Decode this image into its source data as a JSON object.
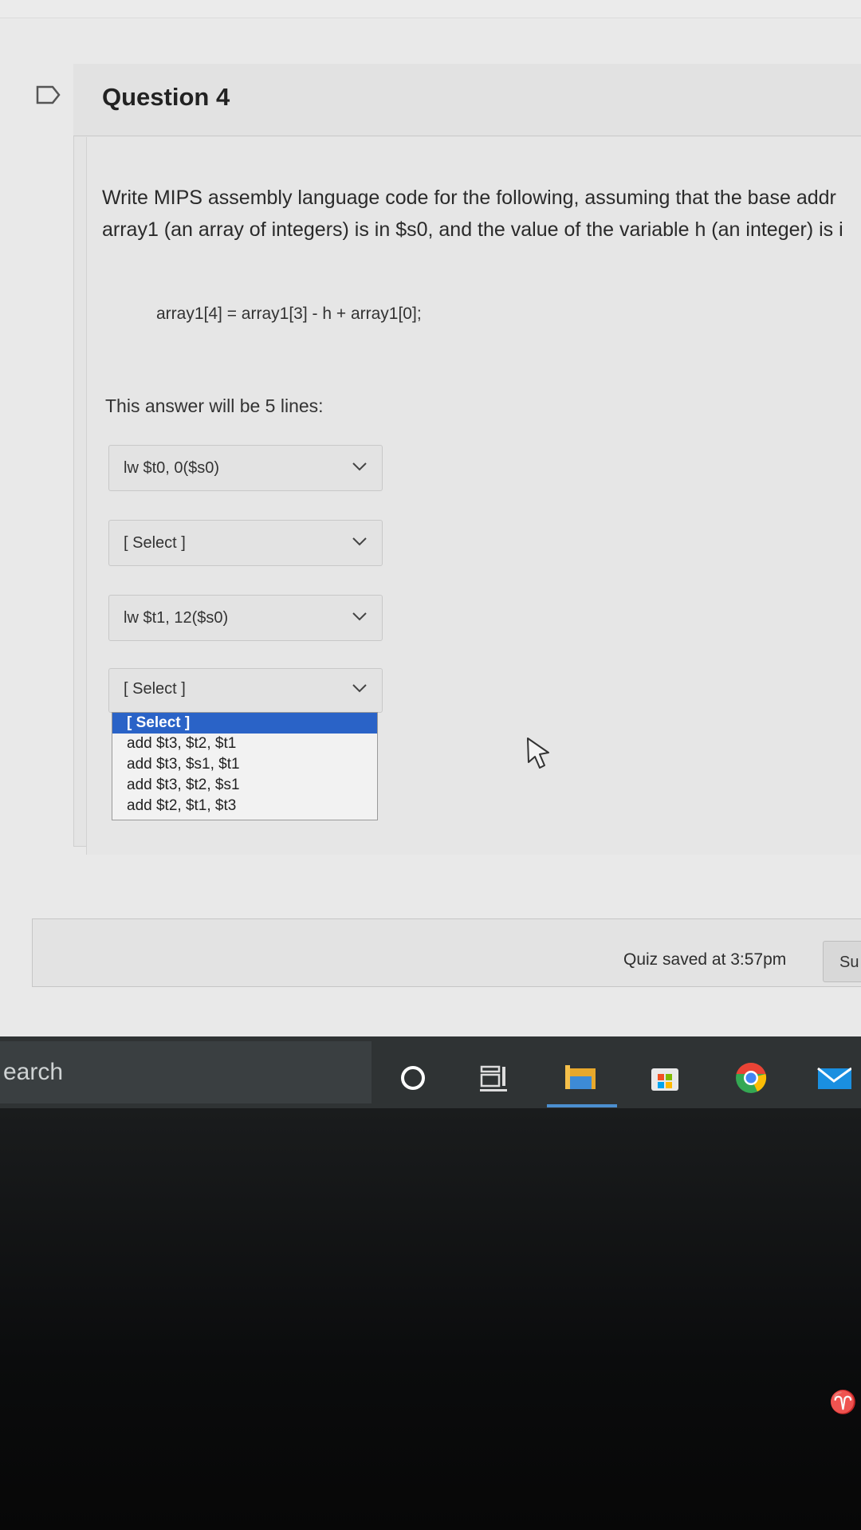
{
  "question": {
    "title": "Question 4",
    "prompt_line1": "Write MIPS assembly language code for the following, assuming that the base addr",
    "prompt_line2": "array1 (an array of integers) is in $s0, and the value of the variable h (an integer) is i",
    "code": "array1[4] = array1[3] - h + array1[0];",
    "hint": "This answer will be 5 lines:"
  },
  "selects": [
    {
      "value": "lw $t0, 0($s0)"
    },
    {
      "value": "[ Select ]"
    },
    {
      "value": "lw $t1, 12($s0)"
    },
    {
      "value": "[ Select ]"
    }
  ],
  "dropdown": {
    "options": [
      "[ Select ]",
      "add $t3, $t2, $t1",
      "add $t3, $s1, $t1",
      "add $t3, $t2, $s1",
      "add $t2, $t1, $t3"
    ],
    "highlighted_index": 0
  },
  "footer": {
    "saved_text": "Quiz saved at 3:57pm",
    "submit_label": "Su"
  },
  "taskbar": {
    "search_text": "earch",
    "icons": [
      "cortana-circle-icon",
      "task-view-icon",
      "file-explorer-icon",
      "microsoft-store-icon",
      "chrome-icon",
      "mail-icon"
    ]
  },
  "colors": {
    "highlight": "#2a63c7",
    "taskbar_underline": "#4b8fd0"
  }
}
